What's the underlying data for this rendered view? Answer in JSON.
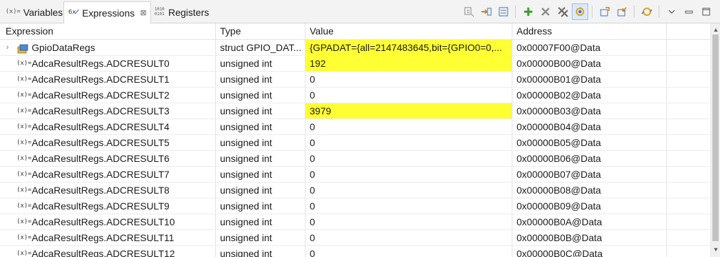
{
  "tabs": [
    {
      "label": "Variables",
      "icon": "variables-icon",
      "icon_text": "(x)=",
      "active": false
    },
    {
      "label": "Expressions",
      "icon": "expressions-icon",
      "icon_text": "6x",
      "active": true,
      "close": "⊠"
    },
    {
      "label": "Registers",
      "icon": "registers-icon",
      "icon_text": "1010",
      "active": false
    }
  ],
  "toolbar": {
    "buttons": [
      "collapse-all-icon",
      "expand-icon",
      "show-type-names-icon",
      "add-expression-icon",
      "remove-expression-icon",
      "remove-all-icon",
      "refresh-icon",
      "export-icon",
      "import-icon",
      "continuous-refresh-icon",
      "view-menu-icon",
      "minimize-icon",
      "maximize-icon"
    ],
    "pressed": "refresh-icon"
  },
  "columns": {
    "expression": "Expression",
    "type": "Type",
    "value": "Value",
    "address": "Address"
  },
  "rows": [
    {
      "expression": "GpioDataRegs",
      "type": "struct GPIO_DAT...",
      "value": "{GPADAT={all=2147483645,bit={GPIO0=0,...",
      "address": "0x00007F00@Data",
      "changed": true,
      "expandable": true,
      "icon": "struct-icon"
    },
    {
      "expression": "AdcaResultRegs.ADCRESULT0",
      "type": "unsigned int",
      "value": "192",
      "address": "0x00000B00@Data",
      "changed": true,
      "icon": "expression-icon"
    },
    {
      "expression": "AdcaResultRegs.ADCRESULT1",
      "type": "unsigned int",
      "value": "0",
      "address": "0x00000B01@Data",
      "changed": false,
      "icon": "expression-icon"
    },
    {
      "expression": "AdcaResultRegs.ADCRESULT2",
      "type": "unsigned int",
      "value": "0",
      "address": "0x00000B02@Data",
      "changed": false,
      "icon": "expression-icon"
    },
    {
      "expression": "AdcaResultRegs.ADCRESULT3",
      "type": "unsigned int",
      "value": "3979",
      "address": "0x00000B03@Data",
      "changed": true,
      "icon": "expression-icon"
    },
    {
      "expression": "AdcaResultRegs.ADCRESULT4",
      "type": "unsigned int",
      "value": "0",
      "address": "0x00000B04@Data",
      "changed": false,
      "icon": "expression-icon"
    },
    {
      "expression": "AdcaResultRegs.ADCRESULT5",
      "type": "unsigned int",
      "value": "0",
      "address": "0x00000B05@Data",
      "changed": false,
      "icon": "expression-icon"
    },
    {
      "expression": "AdcaResultRegs.ADCRESULT6",
      "type": "unsigned int",
      "value": "0",
      "address": "0x00000B06@Data",
      "changed": false,
      "icon": "expression-icon"
    },
    {
      "expression": "AdcaResultRegs.ADCRESULT7",
      "type": "unsigned int",
      "value": "0",
      "address": "0x00000B07@Data",
      "changed": false,
      "icon": "expression-icon"
    },
    {
      "expression": "AdcaResultRegs.ADCRESULT8",
      "type": "unsigned int",
      "value": "0",
      "address": "0x00000B08@Data",
      "changed": false,
      "icon": "expression-icon"
    },
    {
      "expression": "AdcaResultRegs.ADCRESULT9",
      "type": "unsigned int",
      "value": "0",
      "address": "0x00000B09@Data",
      "changed": false,
      "icon": "expression-icon"
    },
    {
      "expression": "AdcaResultRegs.ADCRESULT10",
      "type": "unsigned int",
      "value": "0",
      "address": "0x00000B0A@Data",
      "changed": false,
      "icon": "expression-icon"
    },
    {
      "expression": "AdcaResultRegs.ADCRESULT11",
      "type": "unsigned int",
      "value": "0",
      "address": "0x00000B0B@Data",
      "changed": false,
      "icon": "expression-icon"
    },
    {
      "expression": "AdcaResultRegs.ADCRESULT12",
      "type": "unsigned int",
      "value": "0",
      "address": "0x00000B0C@Data",
      "changed": false,
      "icon": "expression-icon"
    }
  ],
  "expression_icon_text": "(x)=",
  "colors": {
    "changed_highlight": "#ffff33",
    "pressed_button": "#dbe9f8",
    "tabbar_bg": "#f3f3f3"
  }
}
